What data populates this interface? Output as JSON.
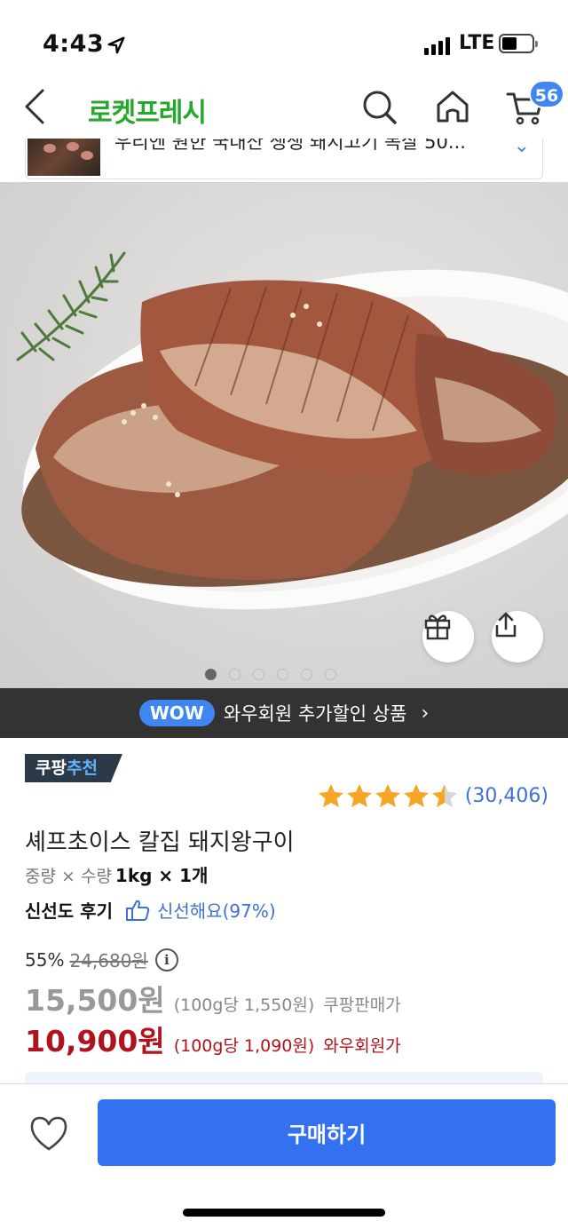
{
  "status_bar": {
    "time": "4:43",
    "carrier": "LTE",
    "battery_level": 0.4
  },
  "header": {
    "title": "로켓프레시",
    "cart_count": "56"
  },
  "banner": {
    "text": "우리엔 원한 국내산 생생 돼지고기 목살 50..."
  },
  "gallery": {
    "image_count": 6,
    "active_index": 0
  },
  "wow_bar": {
    "badge": "WOW",
    "text": "와우회원 추가할인 상품",
    "arrow": "›"
  },
  "product": {
    "badge_prefix": "쿠팡",
    "badge_accent": "추천",
    "rating": 4.5,
    "review_count": "(30,406)",
    "name": "셰프초이스 칼집 돼지왕구이",
    "spec_label": "중량 × 수량",
    "spec_value": "1kg × 1개",
    "freshness_label": "신선도 후기",
    "freshness_value": "신선해요(97%)",
    "discount_rate": "55%",
    "original_price": "24,680원",
    "info_icon": "i",
    "price": "15,500원",
    "price_unit": "(100g당 1,550원)",
    "price_seller": "쿠팡판매가",
    "wow_price": "10,900원",
    "wow_unit": "(100g당 1,090원)",
    "wow_seller": "와우회원가"
  },
  "bottom_bar": {
    "buy_label": "구매하기"
  },
  "colors": {
    "brand_green": "#27a82c",
    "accent_blue": "#3471f0",
    "wow_red": "#b0131d",
    "star": "#f5a623"
  }
}
